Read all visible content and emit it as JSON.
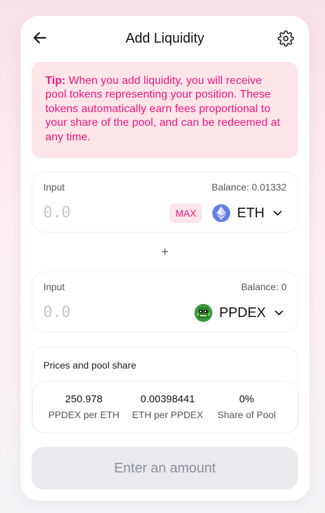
{
  "header": {
    "title": "Add Liquidity",
    "back_icon": "arrow-left-icon",
    "settings_icon": "gear-icon"
  },
  "tip": {
    "label": "Tip:",
    "text": " When you add liquidity, you will receive pool tokens representing your position. These tokens automatically earn fees proportional to your share of the pool, and can be redeemed at any time."
  },
  "input_a": {
    "label": "Input",
    "balance": "Balance: 0.01332",
    "placeholder": "0.0",
    "max_label": "MAX",
    "token": "ETH",
    "token_icon": "eth-icon"
  },
  "plus": "+",
  "input_b": {
    "label": "Input",
    "balance": "Balance: 0",
    "placeholder": "0.0",
    "token": "PPDEX",
    "token_icon": "ppdex-icon"
  },
  "prices": {
    "title": "Prices and pool share",
    "stats": [
      {
        "value": "250.978",
        "label": "PPDEX per ETH"
      },
      {
        "value": "0.00398441",
        "label": "ETH per PPDEX"
      },
      {
        "value": "0%",
        "label": "Share of Pool"
      }
    ]
  },
  "submit_label": "Enter an amount",
  "colors": {
    "accent": "#f0157f",
    "tip_bg": "#fde5ea",
    "eth": "#627eea",
    "button_bg": "#e9eaee"
  }
}
